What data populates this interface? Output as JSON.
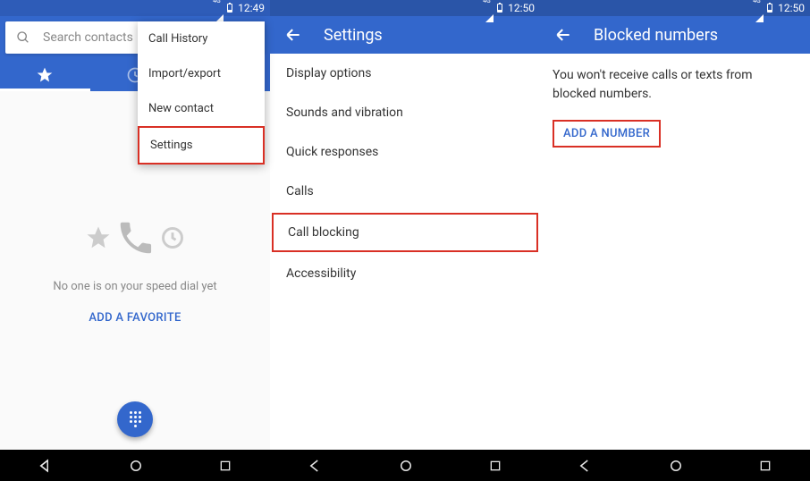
{
  "screen1": {
    "status": {
      "time": "12:49"
    },
    "search": {
      "placeholder": "Search contacts"
    },
    "menu": {
      "items": [
        {
          "label": "Call History"
        },
        {
          "label": "Import/export"
        },
        {
          "label": "New contact"
        },
        {
          "label": "Settings"
        }
      ]
    },
    "empty": {
      "text": "No one is on your speed dial yet",
      "action": "ADD A FAVORITE"
    }
  },
  "screen2": {
    "status": {
      "time": "12:50"
    },
    "title": "Settings",
    "items": [
      {
        "label": "Display options"
      },
      {
        "label": "Sounds and vibration"
      },
      {
        "label": "Quick responses"
      },
      {
        "label": "Calls"
      },
      {
        "label": "Call blocking"
      },
      {
        "label": "Accessibility"
      }
    ]
  },
  "screen3": {
    "status": {
      "time": "12:50"
    },
    "title": "Blocked numbers",
    "description": "You won't receive calls or texts from blocked numbers.",
    "action": "ADD A NUMBER"
  }
}
